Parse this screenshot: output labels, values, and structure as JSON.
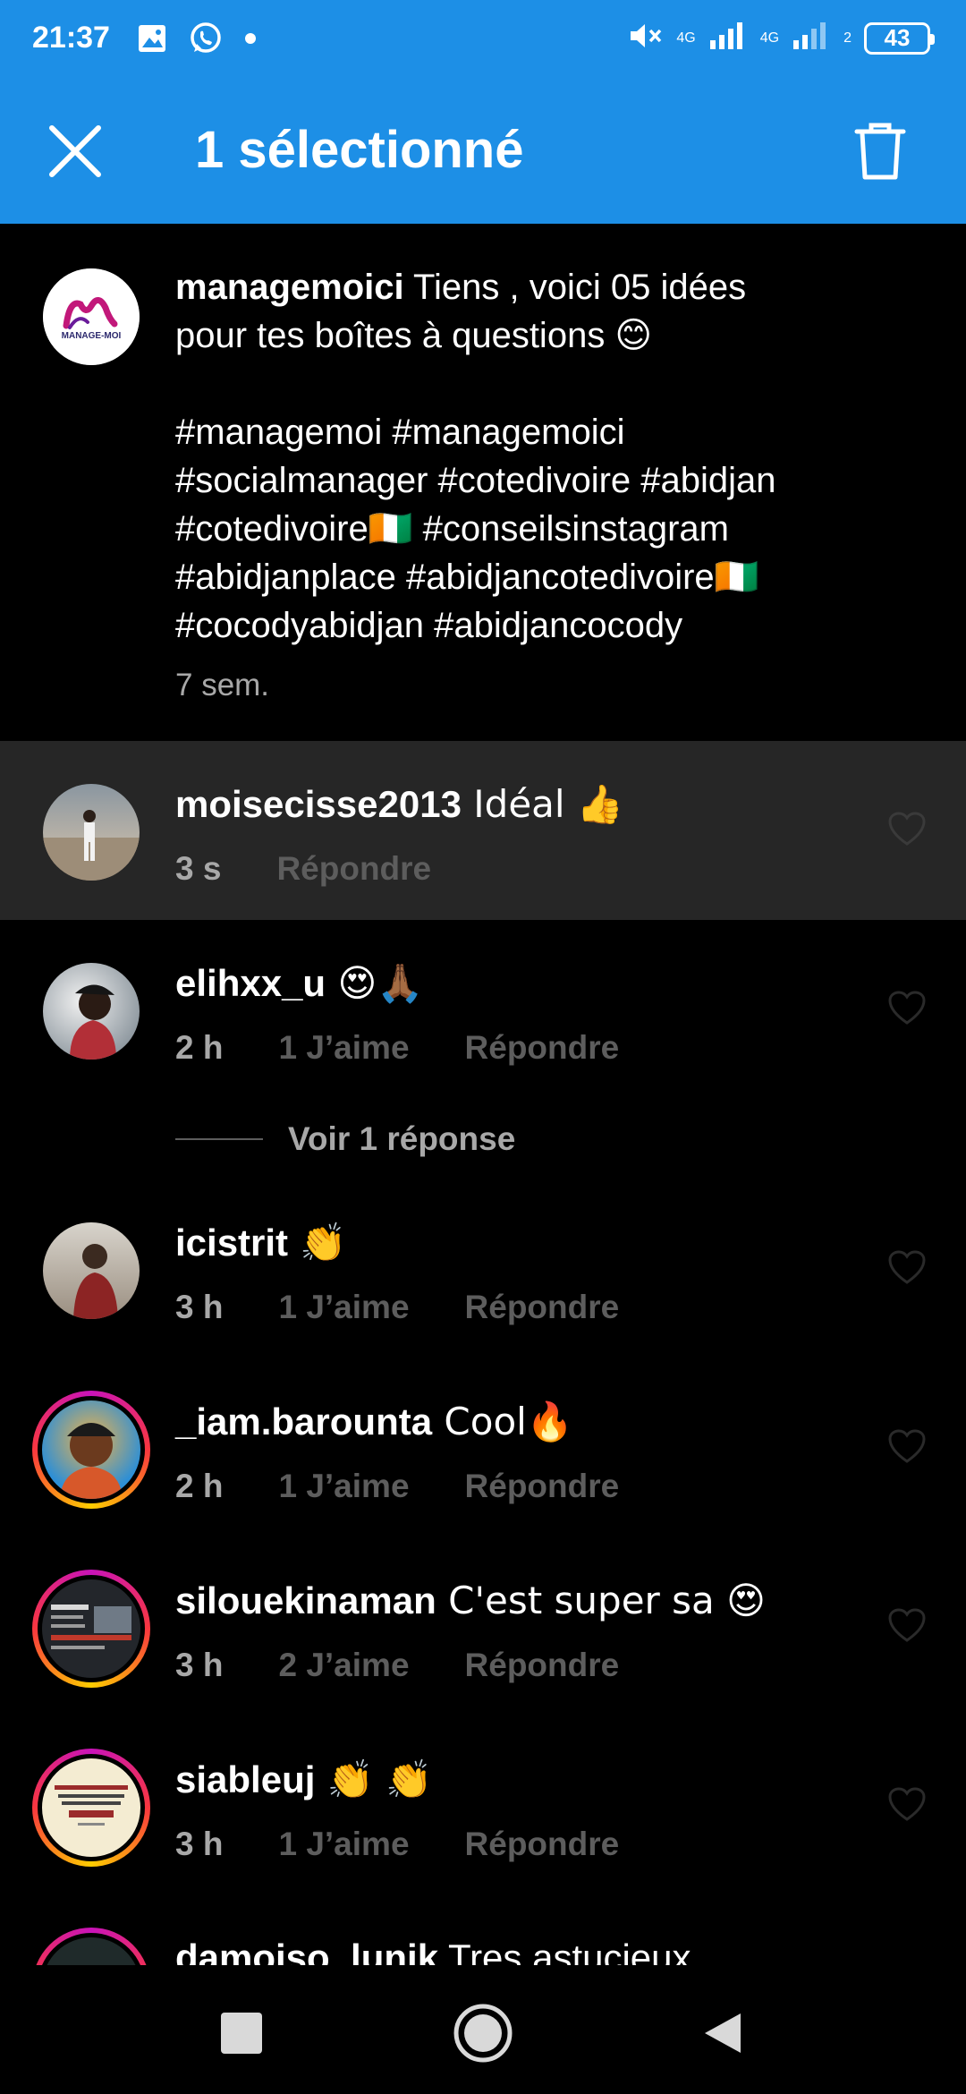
{
  "status_bar": {
    "time": "21:37",
    "left_icons": [
      "gallery-icon",
      "whatsapp-icon",
      "dot-icon"
    ],
    "sim1_net": "4G",
    "sim2_net": "4G",
    "sim2_index": "1",
    "sim2_badge": "2",
    "battery": "43"
  },
  "header": {
    "title": "1 sélectionné",
    "close_icon": "close-icon",
    "delete_icon": "trash-icon",
    "background": "#1d8fe6"
  },
  "caption": {
    "username": "managemoici",
    "text_line1": " Tiens , voici 05 idées",
    "text_line2": "pour tes boîtes à questions 😊",
    "tags_line1": "#managemoi #managemoici",
    "tags_line2": "#socialmanager #cotedivoire #abidjan",
    "tags_line3": "#cotedivoire🇨🇮 #conseilsinstagram",
    "tags_line4": "#abidjanplace #abidjancotedivoire🇨🇮",
    "tags_line5": "#cocodyabidjan #abidjancocody",
    "time": "7 sem.",
    "logo_text": "MANAGE-MOI"
  },
  "comments": [
    {
      "username": "moisecisse2013",
      "text": " Idéal 👍",
      "time": "3 s",
      "likes": "",
      "reply": "Répondre",
      "selected": true
    },
    {
      "username": "elihxx_u",
      "text": " 😍🙏🏾",
      "time": "2 h",
      "likes": "1 J’aime",
      "reply": "Répondre"
    },
    {
      "username": "icistrit",
      "text": " 👏",
      "time": "3 h",
      "likes": "1 J’aime",
      "reply": "Répondre"
    },
    {
      "username": "_iam.barounta",
      "text": " Cool🔥",
      "time": "2 h",
      "likes": "1 J’aime",
      "reply": "Répondre"
    },
    {
      "username": "silouekinaman",
      "text": " C'est super sa 😍",
      "time": "3 h",
      "likes": "2 J’aime",
      "reply": "Répondre"
    },
    {
      "username": "siableuj",
      "text": " 👏 👏",
      "time": "3 h",
      "likes": "1 J’aime",
      "reply": "Répondre"
    },
    {
      "username": "damoiso_lunik",
      "text": " Tres astucieux"
    }
  ],
  "view_replies": "Voir 1 réponse",
  "nav": {
    "recent": "recent-apps-icon",
    "home": "home-icon",
    "back": "back-icon"
  }
}
